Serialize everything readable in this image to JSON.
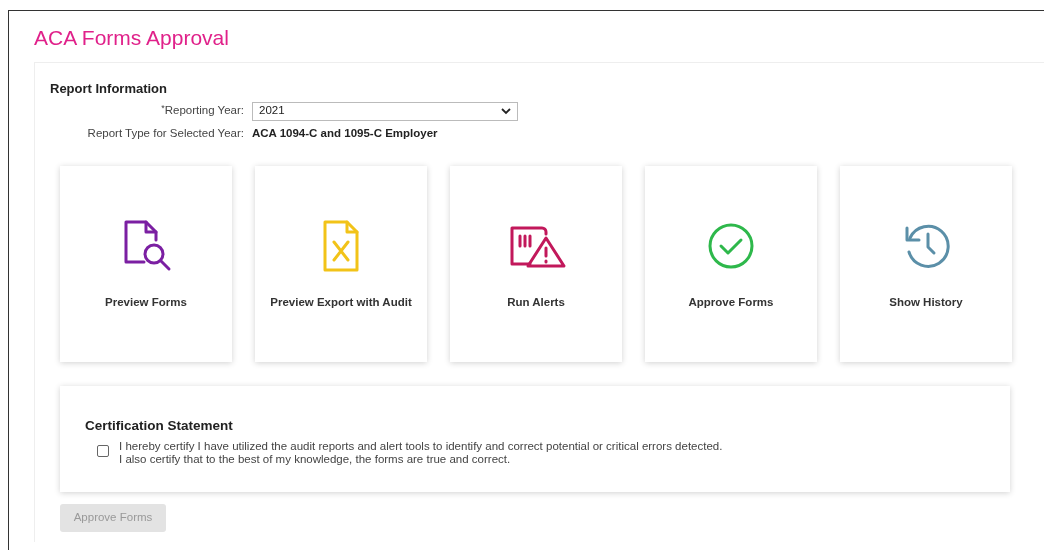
{
  "page": {
    "title": "ACA Forms Approval"
  },
  "report_information": {
    "heading": "Report Information",
    "required_mark": "*",
    "year_label": "Reporting Year:",
    "year_value": "2021",
    "type_label": "Report Type for Selected Year:",
    "type_value": "ACA 1094-C and 1095-C Employer"
  },
  "actions": [
    {
      "kind": "preview",
      "label": "Preview Forms",
      "color": "#7b1fa2"
    },
    {
      "kind": "export",
      "label": "Preview Export with Audit",
      "color": "#f2c318"
    },
    {
      "kind": "alerts",
      "label": "Run Alerts",
      "color": "#c2185b"
    },
    {
      "kind": "approve",
      "label": "Approve Forms",
      "color": "#2eb84b"
    },
    {
      "kind": "history",
      "label": "Show History",
      "color": "#5b8fa8"
    }
  ],
  "certification": {
    "heading": "Certification Statement",
    "checked": false,
    "lines": [
      "I hereby certify I have utilized the audit reports and alert tools to identify and correct potential or critical errors detected.",
      "I also certify that to the best of my knowledge, the forms are true and correct."
    ]
  },
  "approve_button": {
    "label": "Approve Forms",
    "disabled": true
  }
}
